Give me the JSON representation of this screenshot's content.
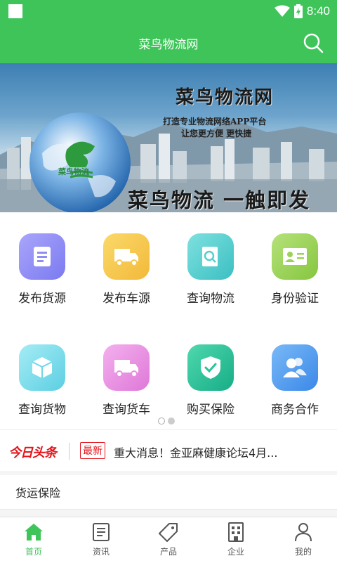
{
  "status": {
    "time": "8:40"
  },
  "header": {
    "title": "菜鸟物流网"
  },
  "banner": {
    "title": "菜鸟物流网",
    "subtitle_line1": "打造专业物流网络APP平台",
    "subtitle_line2": "让您更方便 更快捷",
    "slogan": "菜鸟物流 一触即发",
    "logo_text": "菜鸟物流"
  },
  "grid": {
    "items": [
      {
        "label": "发布货源",
        "icon": "document-icon",
        "color": "#8f8ef5"
      },
      {
        "label": "发布车源",
        "icon": "truck-icon",
        "color": "#f5c84a"
      },
      {
        "label": "查询物流",
        "icon": "search-document-icon",
        "color": "#55cfd0"
      },
      {
        "label": "身份验证",
        "icon": "id-card-icon",
        "color": "#9bd35a"
      },
      {
        "label": "查询货物",
        "icon": "box-icon",
        "color": "#6fd7e8"
      },
      {
        "label": "查询货车",
        "icon": "truck-icon",
        "color": "#e98ee0"
      },
      {
        "label": "购买保险",
        "icon": "shield-check-icon",
        "color": "#27c39a"
      },
      {
        "label": "商务合作",
        "icon": "users-icon",
        "color": "#4c9cf0"
      }
    ]
  },
  "news": {
    "logo": "今日头条",
    "badge": "最新",
    "headline": "重大消息！金亚麻健康论坛4月..."
  },
  "section": {
    "title": "货运保险"
  },
  "tabs": [
    {
      "label": "首页",
      "icon": "home-icon",
      "active": true
    },
    {
      "label": "资讯",
      "icon": "news-icon"
    },
    {
      "label": "产品",
      "icon": "tag-icon"
    },
    {
      "label": "企业",
      "icon": "building-icon"
    },
    {
      "label": "我的",
      "icon": "person-icon"
    }
  ],
  "colors": {
    "brand": "#3fc45a",
    "news_red": "#e4141c"
  }
}
